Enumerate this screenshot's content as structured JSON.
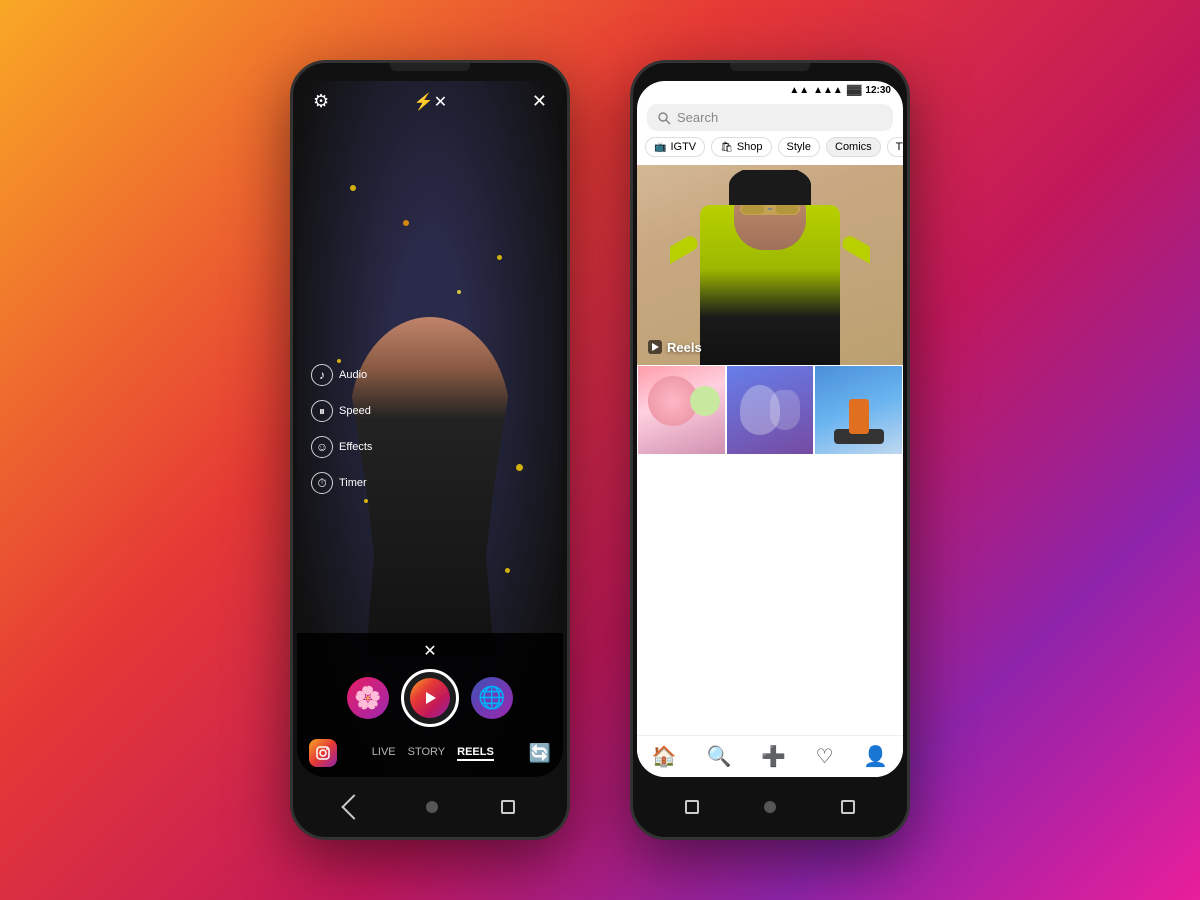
{
  "background": {
    "gradient": "linear-gradient(135deg, #f9a825 0%, #e53935 35%, #c2185b 60%, #8e24aa 80%, #e91e9a 100%)"
  },
  "left_phone": {
    "mode_tabs": [
      "LIVE",
      "STORY",
      "REELS"
    ],
    "active_mode": "REELS",
    "menu_items": [
      {
        "icon": "♪",
        "label": "Audio"
      },
      {
        "icon": "⏸",
        "label": "Speed"
      },
      {
        "icon": "☺",
        "label": "Effects"
      },
      {
        "icon": "⏱",
        "label": "Timer"
      }
    ],
    "top_icons": {
      "settings": "⚙",
      "flash": "⚡",
      "close": "✕"
    }
  },
  "right_phone": {
    "status_bar": {
      "time": "12:30",
      "wifi": "▲▲",
      "signal": "▲▲▲",
      "battery": "🔋"
    },
    "search_placeholder": "Search",
    "filter_tags": [
      {
        "icon": "📺",
        "label": "IGTV"
      },
      {
        "icon": "🛍",
        "label": "Shop"
      },
      {
        "icon": "✨",
        "label": "Style"
      },
      {
        "icon": "💬",
        "label": "Comics"
      },
      {
        "icon": "🎬",
        "label": "TV & Movies"
      }
    ],
    "reels_label": "Reels",
    "bottom_nav_icons": [
      "🏠",
      "🔍",
      "➕",
      "♡",
      "👤"
    ]
  }
}
